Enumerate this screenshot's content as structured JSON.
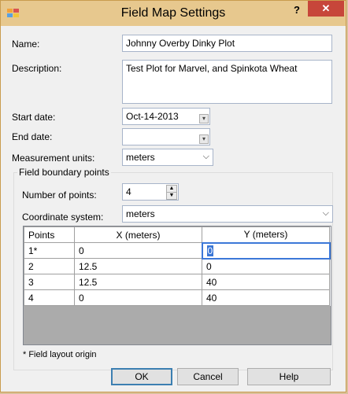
{
  "window": {
    "title": "Field Map Settings",
    "help_glyph": "?",
    "close_glyph": "✕"
  },
  "form": {
    "name_label": "Name:",
    "name_value": "Johnny Overby Dinky Plot",
    "description_label": "Description:",
    "description_value": "Test Plot for Marvel, and Spinkota Wheat",
    "start_date_label": "Start date:",
    "start_date_value": "Oct-14-2013",
    "end_date_label": "End date:",
    "end_date_value": "",
    "units_label": "Measurement units:",
    "units_value": "meters"
  },
  "boundary": {
    "group_title": "Field boundary points",
    "num_points_label": "Number of points:",
    "num_points_value": "4",
    "coord_label": "Coordinate system:",
    "coord_value": "meters",
    "columns": [
      "Points",
      "X (meters)",
      "Y (meters)"
    ],
    "rows": [
      {
        "point": "1*",
        "x": "0",
        "y": "0"
      },
      {
        "point": "2",
        "x": "12.5",
        "y": "0"
      },
      {
        "point": "3",
        "x": "12.5",
        "y": "40"
      },
      {
        "point": "4",
        "x": "0",
        "y": "40"
      }
    ],
    "note": "* Field layout origin"
  },
  "buttons": {
    "ok": "OK",
    "cancel": "Cancel",
    "help": "Help"
  },
  "icons": {
    "app": "window-app-icon",
    "dropdown": "chevron-down-icon",
    "calendar": "calendar-dropdown-icon"
  },
  "colors": {
    "titlebar": "#e7c88e",
    "close": "#c7463a",
    "selection": "#3a76d6"
  }
}
